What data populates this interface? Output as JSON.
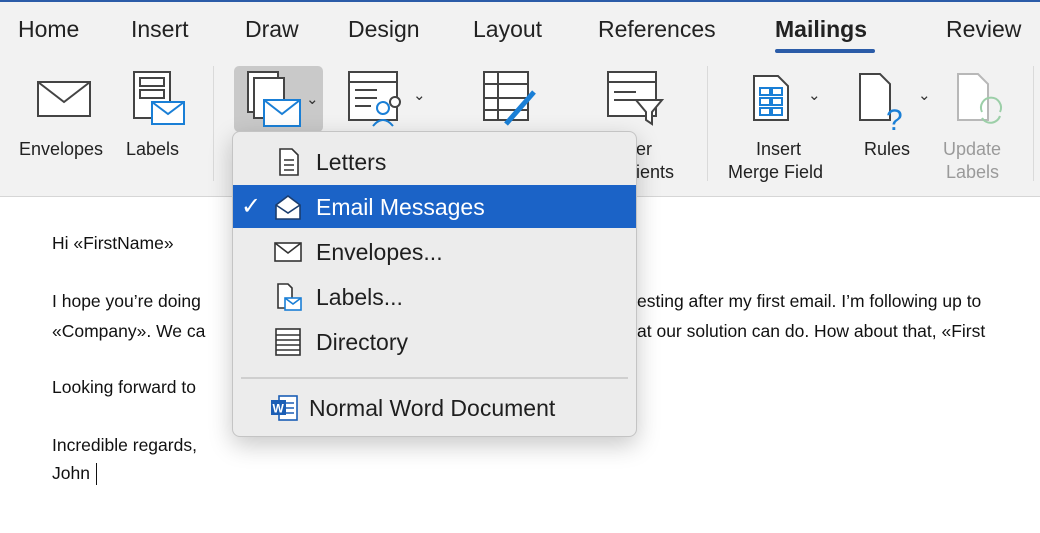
{
  "tabs": [
    {
      "label": "Home"
    },
    {
      "label": "Insert"
    },
    {
      "label": "Draw"
    },
    {
      "label": "Design"
    },
    {
      "label": "Layout"
    },
    {
      "label": "References"
    },
    {
      "label": "Mailings",
      "active": true
    },
    {
      "label": "Review"
    }
  ],
  "ribbon": {
    "envelopes": "Envelopes",
    "labels": "Labels",
    "filter_recipients_line1": "er",
    "filter_recipients_line2": "ients",
    "insert_merge_field_line1": "Insert",
    "insert_merge_field_line2": "Merge Field",
    "rules": "Rules",
    "update_labels_line1": "Update",
    "update_labels_line2": "Labels"
  },
  "menu": {
    "items": [
      {
        "label": "Letters",
        "icon": "document-icon",
        "checked": false
      },
      {
        "label": "Email Messages",
        "icon": "open-envelope-icon",
        "checked": true
      },
      {
        "label": "Envelopes...",
        "icon": "envelope-icon",
        "checked": false
      },
      {
        "label": "Labels...",
        "icon": "labels-icon",
        "checked": false
      },
      {
        "label": "Directory",
        "icon": "directory-icon",
        "checked": false
      }
    ],
    "normal": {
      "label": "Normal Word Document",
      "icon": "word-document-icon"
    },
    "check_glyph": "✓"
  },
  "document": {
    "greeting": "Hi «FirstName»",
    "para1_line1_left": "I hope you’re doing",
    "para1_line1_right": "esting after my first email. I’m following up to",
    "para1_line2_left": "«Company». We ca",
    "para1_line2_right": "at our solution can do. How about that, «First",
    "closing_left": "Looking forward to",
    "signoff": "Incredible regards,",
    "name": "John"
  },
  "colors": {
    "accent": "#2b5ca8",
    "selection": "#1b63c7",
    "icon_blue": "#1a7fd6"
  }
}
